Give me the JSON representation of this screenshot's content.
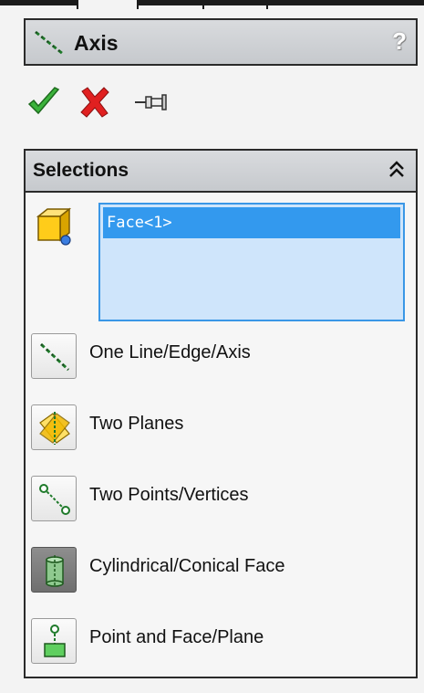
{
  "header": {
    "title": "Axis",
    "help_label": "?",
    "icon": "axis-icon"
  },
  "actions": {
    "ok_icon": "checkmark-icon",
    "cancel_icon": "close-icon",
    "pin_icon": "pushpin-icon"
  },
  "selections": {
    "heading": "Selections",
    "collapse_icon": "double-chevron-up-icon",
    "list": [
      "Face<1>"
    ],
    "options": [
      {
        "label": "One Line/Edge/Axis",
        "icon": "line-edge-axis-icon"
      },
      {
        "label": "Two Planes",
        "icon": "two-planes-icon"
      },
      {
        "label": "Two Points/Vertices",
        "icon": "two-points-icon"
      },
      {
        "label": "Cylindrical/Conical Face",
        "icon": "cylinder-icon"
      },
      {
        "label": "Point and Face/Plane",
        "icon": "point-face-icon"
      }
    ]
  },
  "colors": {
    "accent": "#3399ee",
    "list_bg": "#cfe5fb",
    "ok": "#3cb33c",
    "cancel": "#e02020"
  }
}
